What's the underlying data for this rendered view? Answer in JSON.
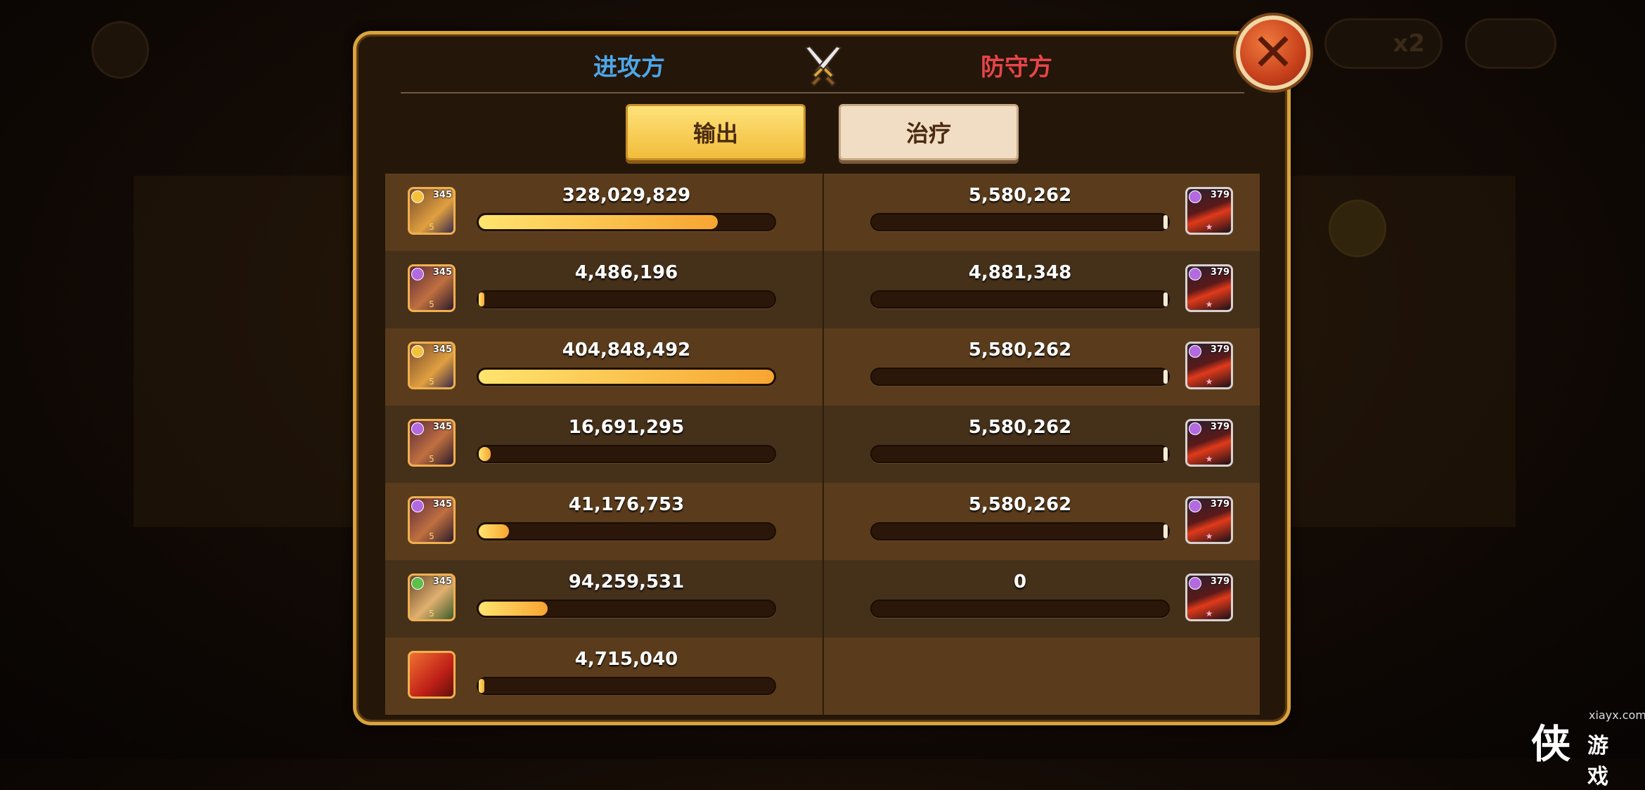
{
  "header": {
    "attacker_title": "进攻方",
    "defender_title": "防守方"
  },
  "tabs": {
    "output_label": "输出",
    "heal_label": "治疗"
  },
  "colors": {
    "attacker": "#4ea6e8",
    "defender": "#e8454a",
    "accent_gold": "#f1bd3b"
  },
  "attackers": [
    {
      "value": "328,029,829",
      "fraction": 0.81,
      "level": "345",
      "element": "light",
      "stars": "5"
    },
    {
      "value": "4,486,196",
      "fraction": 0.011,
      "level": "345",
      "element": "dark",
      "stars": "5"
    },
    {
      "value": "404,848,492",
      "fraction": 1.0,
      "level": "345",
      "element": "light",
      "stars": "5"
    },
    {
      "value": "16,691,295",
      "fraction": 0.041,
      "level": "345",
      "element": "dark",
      "stars": "5"
    },
    {
      "value": "41,176,753",
      "fraction": 0.102,
      "level": "345",
      "element": "dark",
      "stars": "5"
    },
    {
      "value": "94,259,531",
      "fraction": 0.233,
      "level": "345",
      "element": "forest",
      "stars": "5"
    },
    {
      "value": "4,715,040",
      "fraction": 0.012,
      "level": "",
      "element": "pet",
      "stars": ""
    }
  ],
  "defenders": [
    {
      "value": "5,580,262",
      "fraction": 0.014,
      "level": "379",
      "element": "dark",
      "stars": "★"
    },
    {
      "value": "4,881,348",
      "fraction": 0.012,
      "level": "379",
      "element": "dark",
      "stars": "★"
    },
    {
      "value": "5,580,262",
      "fraction": 0.014,
      "level": "379",
      "element": "dark",
      "stars": "★"
    },
    {
      "value": "5,580,262",
      "fraction": 0.014,
      "level": "379",
      "element": "dark",
      "stars": "★"
    },
    {
      "value": "5,580,262",
      "fraction": 0.014,
      "level": "379",
      "element": "dark",
      "stars": "★"
    },
    {
      "value": "0",
      "fraction": 0.0,
      "level": "379",
      "element": "dark",
      "stars": "★"
    }
  ],
  "icons": {
    "close": "close-icon",
    "crossed_swords": "crossed-swords-icon"
  },
  "background": {
    "speed_label": "x2"
  },
  "watermark": {
    "site": "xiayx.com",
    "big_char": "侠",
    "name": "游戏"
  }
}
